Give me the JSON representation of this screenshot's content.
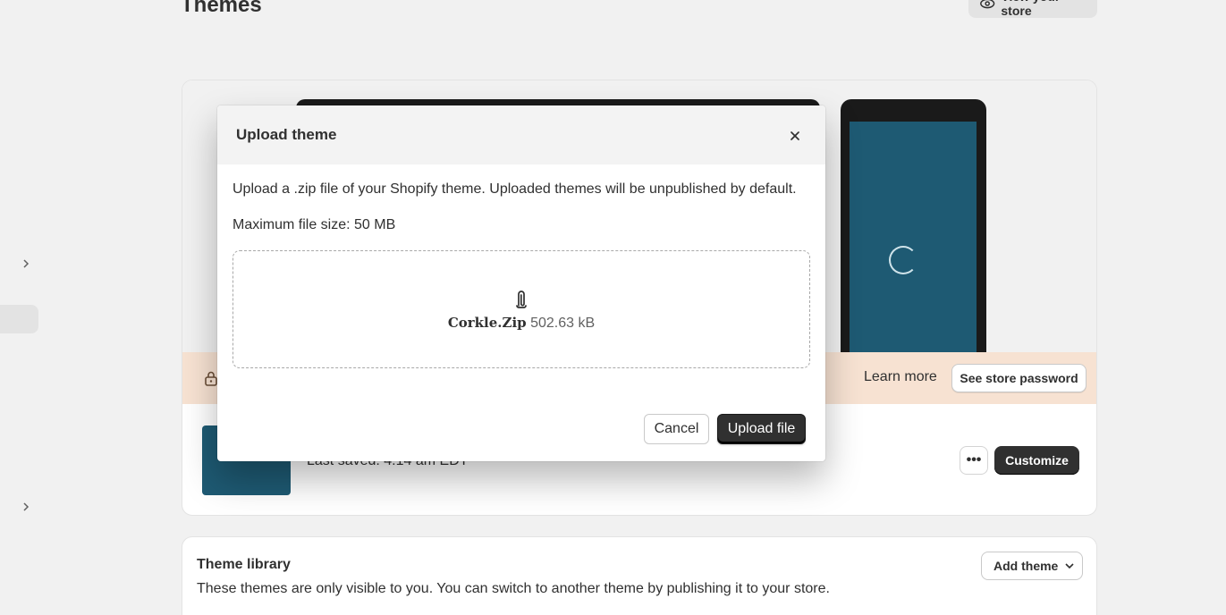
{
  "page": {
    "title": "Themes",
    "view_store_label": "View your store"
  },
  "current_theme": {
    "banner_learn_more": "Learn more",
    "banner_button": "See store password",
    "last_saved": "Last saved: 4:14 am EDT",
    "customize_label": "Customize",
    "more_label": "•••"
  },
  "library": {
    "title": "Theme library",
    "description": "These themes are only visible to you. You can switch to another theme by publishing it to your store.",
    "add_theme_label": "Add theme"
  },
  "modal": {
    "title": "Upload theme",
    "description": "Upload a .zip file of your Shopify theme. Uploaded themes will be unpublished by default.",
    "max_size": "Maximum file size: 50 MB",
    "file_name": "Corkle.Zip",
    "file_size": "502.63 kB",
    "cancel_label": "Cancel",
    "upload_label": "Upload file"
  },
  "colors": {
    "primary_button": "#303030",
    "banner": "#f7e2d2",
    "theme_thumbnail": "#1e5a73"
  }
}
